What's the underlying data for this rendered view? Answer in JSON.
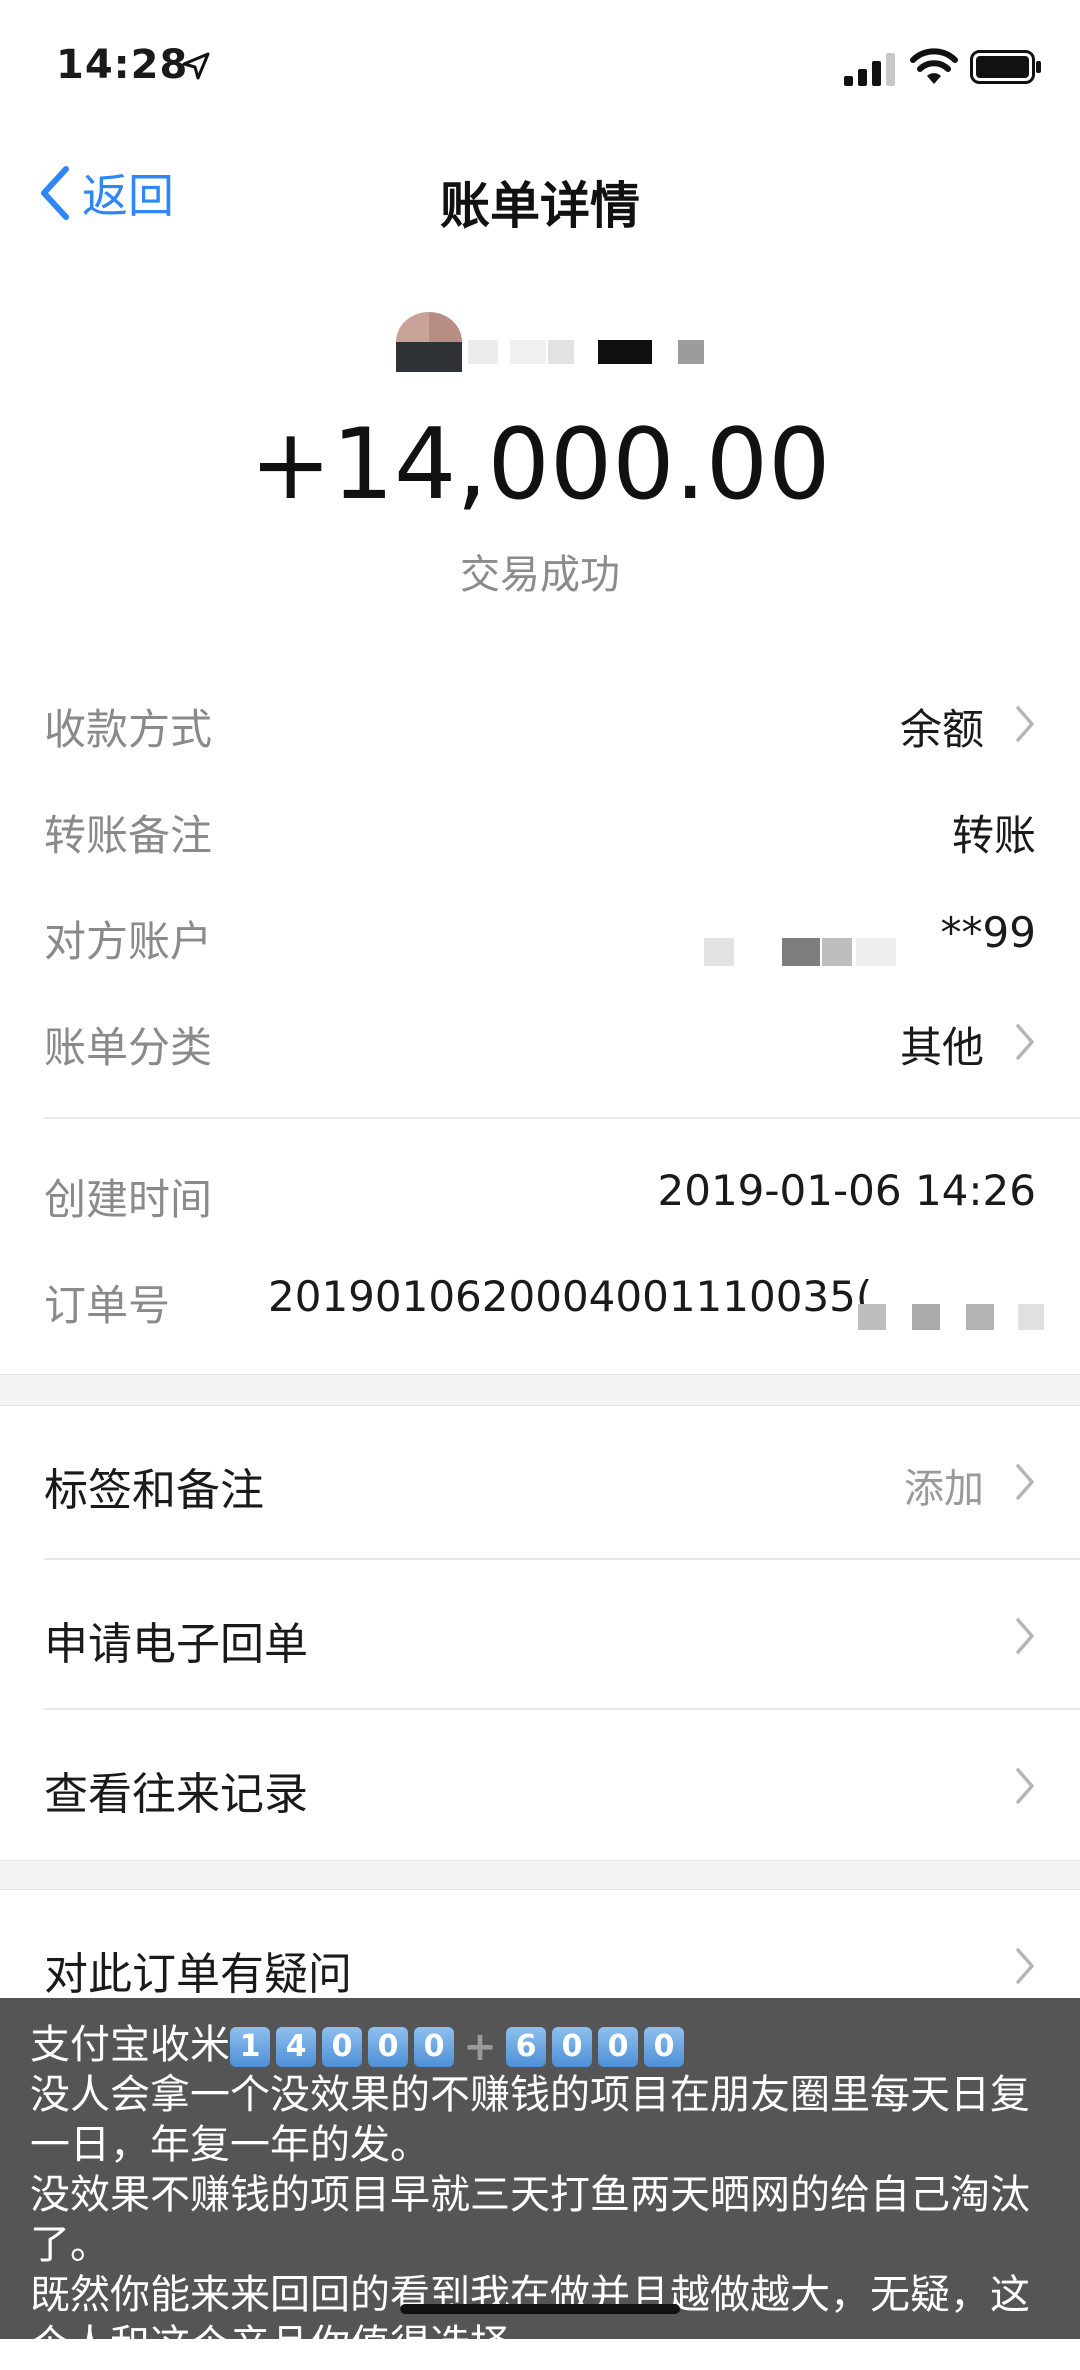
{
  "status_bar": {
    "time": "14:28"
  },
  "nav": {
    "back_label": "返回",
    "title": "账单详情"
  },
  "summary": {
    "amount": "+14,000.00",
    "status": "交易成功"
  },
  "details": [
    {
      "label": "收款方式",
      "value": "余额",
      "chevron": true
    },
    {
      "label": "转账备注",
      "value": "转账",
      "chevron": false
    },
    {
      "label": "对方账户",
      "value": "**99",
      "chevron": false
    },
    {
      "label": "账单分类",
      "value": "其他",
      "chevron": true
    }
  ],
  "meta": [
    {
      "label": "创建时间",
      "value": "2019-01-06 14:26"
    },
    {
      "label": "订单号",
      "value": "2019010620004001110035("
    }
  ],
  "actions": [
    {
      "label": "标签和备注",
      "value": "添加"
    },
    {
      "label": "申请电子回单",
      "value": ""
    },
    {
      "label": "查看往来记录",
      "value": ""
    },
    {
      "label": "对此订单有疑问",
      "value": ""
    }
  ],
  "caption": {
    "line1_prefix": "支付宝收米",
    "digits_a": [
      "1",
      "4",
      "0",
      "0",
      "0"
    ],
    "plus": "+",
    "digits_b": [
      "6",
      "0",
      "0",
      "0"
    ],
    "line2": "没人会拿一个没效果的不赚钱的项目在朋友圈里每天日复一日，年复一年的发。",
    "line3": "没效果不赚钱的项目早就三天打鱼两天晒网的给自己淘汰了。",
    "line4": "既然你能来来回回的看到我在做并且越做越大，无疑，这个人和这个产品你值得选择。..."
  },
  "colors": {
    "accent": "#2f86f6",
    "muted": "#8a8a8a",
    "caption_bg": "#484848"
  }
}
